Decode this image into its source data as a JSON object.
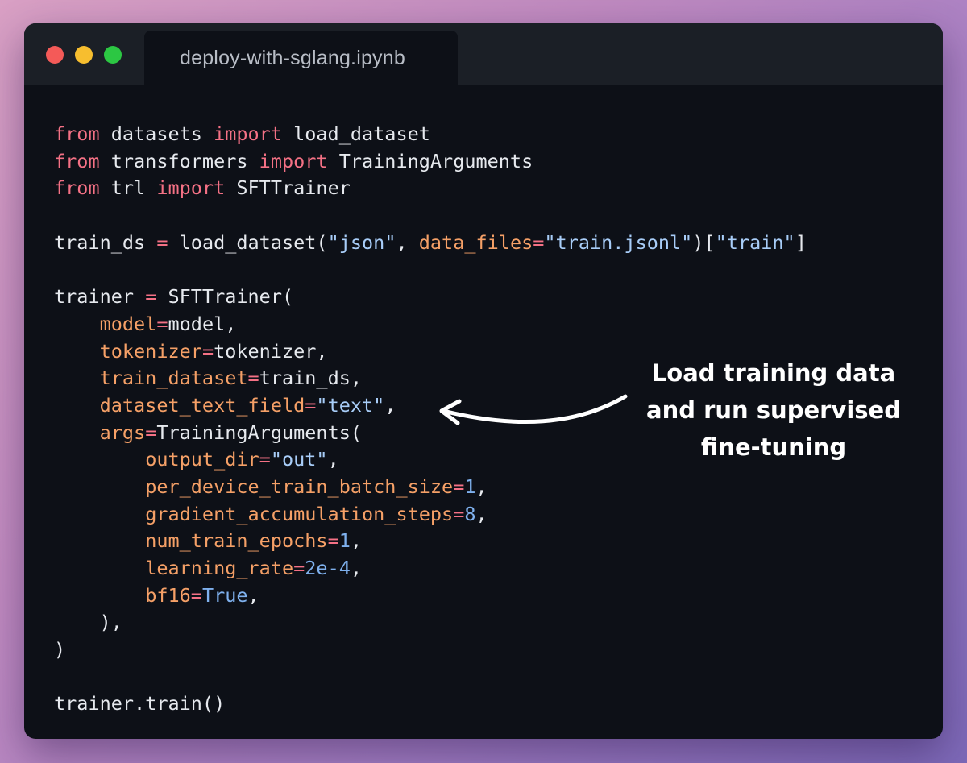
{
  "window": {
    "tab_title": "deploy-with-sglang.ipynb"
  },
  "code_lines": [
    [
      [
        "kw",
        "from"
      ],
      [
        "plain",
        " datasets "
      ],
      [
        "kw",
        "import"
      ],
      [
        "plain",
        " load_dataset"
      ]
    ],
    [
      [
        "kw",
        "from"
      ],
      [
        "plain",
        " transformers "
      ],
      [
        "kw",
        "import"
      ],
      [
        "plain",
        " TrainingArguments"
      ]
    ],
    [
      [
        "kw",
        "from"
      ],
      [
        "plain",
        " trl "
      ],
      [
        "kw",
        "import"
      ],
      [
        "plain",
        " SFTTrainer"
      ]
    ],
    [],
    [
      [
        "plain",
        "train_ds "
      ],
      [
        "kw",
        "="
      ],
      [
        "plain",
        " load_dataset("
      ],
      [
        "str",
        "\"json\""
      ],
      [
        "plain",
        ", "
      ],
      [
        "attr",
        "data_files"
      ],
      [
        "kw",
        "="
      ],
      [
        "str",
        "\"train.jsonl\""
      ],
      [
        "plain",
        ")["
      ],
      [
        "str",
        "\"train\""
      ],
      [
        "plain",
        "]"
      ]
    ],
    [],
    [
      [
        "plain",
        "trainer "
      ],
      [
        "kw",
        "="
      ],
      [
        "plain",
        " SFTTrainer("
      ]
    ],
    [
      [
        "plain",
        "    "
      ],
      [
        "attr",
        "model"
      ],
      [
        "kw",
        "="
      ],
      [
        "plain",
        "model,"
      ]
    ],
    [
      [
        "plain",
        "    "
      ],
      [
        "attr",
        "tokenizer"
      ],
      [
        "kw",
        "="
      ],
      [
        "plain",
        "tokenizer,"
      ]
    ],
    [
      [
        "plain",
        "    "
      ],
      [
        "attr",
        "train_dataset"
      ],
      [
        "kw",
        "="
      ],
      [
        "plain",
        "train_ds,"
      ]
    ],
    [
      [
        "plain",
        "    "
      ],
      [
        "attr",
        "dataset_text_field"
      ],
      [
        "kw",
        "="
      ],
      [
        "str",
        "\"text\""
      ],
      [
        "plain",
        ","
      ]
    ],
    [
      [
        "plain",
        "    "
      ],
      [
        "attr",
        "args"
      ],
      [
        "kw",
        "="
      ],
      [
        "plain",
        "TrainingArguments("
      ]
    ],
    [
      [
        "plain",
        "        "
      ],
      [
        "attr",
        "output_dir"
      ],
      [
        "kw",
        "="
      ],
      [
        "str",
        "\"out\""
      ],
      [
        "plain",
        ","
      ]
    ],
    [
      [
        "plain",
        "        "
      ],
      [
        "attr",
        "per_device_train_batch_size"
      ],
      [
        "kw",
        "="
      ],
      [
        "num",
        "1"
      ],
      [
        "plain",
        ","
      ]
    ],
    [
      [
        "plain",
        "        "
      ],
      [
        "attr",
        "gradient_accumulation_steps"
      ],
      [
        "kw",
        "="
      ],
      [
        "num",
        "8"
      ],
      [
        "plain",
        ","
      ]
    ],
    [
      [
        "plain",
        "        "
      ],
      [
        "attr",
        "num_train_epochs"
      ],
      [
        "kw",
        "="
      ],
      [
        "num",
        "1"
      ],
      [
        "plain",
        ","
      ]
    ],
    [
      [
        "plain",
        "        "
      ],
      [
        "attr",
        "learning_rate"
      ],
      [
        "kw",
        "="
      ],
      [
        "num",
        "2e-4"
      ],
      [
        "plain",
        ","
      ]
    ],
    [
      [
        "plain",
        "        "
      ],
      [
        "attr",
        "bf16"
      ],
      [
        "kw",
        "="
      ],
      [
        "num",
        "True"
      ],
      [
        "plain",
        ","
      ]
    ],
    [
      [
        "plain",
        "    ),"
      ]
    ],
    [
      [
        "plain",
        ")"
      ]
    ],
    [],
    [
      [
        "plain",
        "trainer.train()"
      ]
    ]
  ],
  "annotation": {
    "line1": "Load training data",
    "line2": "and run supervised",
    "line3": "fine-tuning"
  },
  "colors": {
    "keyword": "#f47185",
    "argument": "#f5a067",
    "string": "#a8cdf8",
    "number": "#7fb1ee",
    "text": "#e6e9ee",
    "editor_bg": "#0d1017",
    "titlebar_bg": "#1b1f26"
  }
}
